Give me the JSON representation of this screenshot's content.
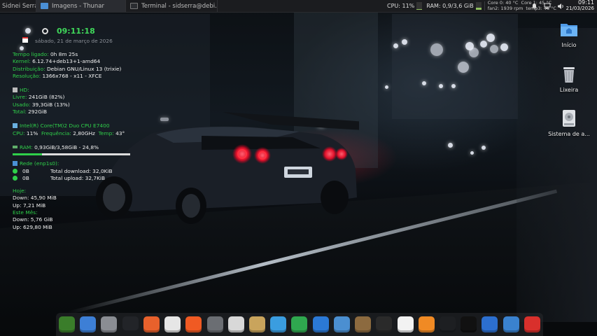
{
  "panel": {
    "user": "Sidnei Serra",
    "tasks": [
      {
        "label": "Imagens - Thunar"
      },
      {
        "label": "Terminal - sidserra@debi..."
      }
    ],
    "cpu_label": "CPU: 11%",
    "cpu_fraction": 0.11,
    "ram_label": "RAM: 0,9/3,6 GiB",
    "ram_fraction": 0.25,
    "sensors": {
      "core0": "Core 0: 40 °C",
      "core1": "Core 1: 45 °C",
      "fan": "fan2: 1939 rpm",
      "temp": "temp3: 46 °C"
    },
    "clock_time": "09:11",
    "clock_date": "21/03/2026"
  },
  "conky": {
    "time": "09:11:18",
    "date": "sábado, 21 de março de 2026",
    "uptime_label": "Tempo ligado:",
    "uptime_value": "0h 8m 25s",
    "kernel_label": "Kernel:",
    "kernel_value": "6.12.74+deb13+1-amd64",
    "distro_label": "Distribuição:",
    "distro_value": "Debian GNU/Linux 13 (trixie)",
    "res_label": "Resolução:",
    "res_value": "1366x768 - x11 - XFCE",
    "hd_title": "HD:",
    "free_label": "Livre:",
    "free_value": "241GiB (82%)",
    "used_label": "Usado:",
    "used_value": "39,3GiB (13%)",
    "total_label": "Total:",
    "total_value": "292GiB",
    "cpu_title": "Intel(R) Core(TM)2 Duo CPU     E7400",
    "cpu_label": "CPU:",
    "cpu_value": "11%",
    "freq_label": "Frequência:",
    "freq_value": "2,80GHz",
    "temp_label": "Temp:",
    "temp_value": "43°",
    "ram_label": "RAM:",
    "ram_value": "0,93GiB/3,58GiB - 24,8%",
    "ram_fraction": 0.248,
    "net_title": "Rede (enp1s0):",
    "down_value": "0B",
    "down_total": "Total download: 32,0KiB",
    "up_value": "0B",
    "up_total": "Total upload: 32,7KiB",
    "today_title": "Hoje:",
    "today_down": "Down: 45,90 MiB",
    "today_up": "Up:  7,21 MiB",
    "month_title": "Este Mês:",
    "month_down": "Down: 5,76 GiB",
    "month_up": "Up: 629,80 MiB"
  },
  "desktop": {
    "icons": [
      {
        "label": "Início",
        "icon": "home-folder-icon"
      },
      {
        "label": "Lixeira",
        "icon": "trash-icon"
      },
      {
        "label": "Sistema de a...",
        "icon": "filesystem-drive-icon"
      }
    ]
  },
  "dock": {
    "apps": [
      {
        "name": "alien-app",
        "color": "#3a7d2a"
      },
      {
        "name": "finder-app",
        "color": "#3d7fd6"
      },
      {
        "name": "settings-app",
        "color": "#8a8d93"
      },
      {
        "name": "terminal-app",
        "color": "#222428"
      },
      {
        "name": "firefox-app",
        "color": "#e8612c"
      },
      {
        "name": "chrome-app",
        "color": "#e6e6e6"
      },
      {
        "name": "brave-app",
        "color": "#f05a23"
      },
      {
        "name": "calculator-app",
        "color": "#6b6e73"
      },
      {
        "name": "screenshot-app",
        "color": "#d8d8d8"
      },
      {
        "name": "archive-app",
        "color": "#c9a45c"
      },
      {
        "name": "telegram-app",
        "color": "#3a9de0"
      },
      {
        "name": "spreadsheet-app",
        "color": "#2fa84f"
      },
      {
        "name": "writer-app",
        "color": "#2b79d6"
      },
      {
        "name": "disk-app",
        "color": "#4b8fd1"
      },
      {
        "name": "image-viewer-app",
        "color": "#8c6a3f"
      },
      {
        "name": "music-app",
        "color": "#2a2a2a"
      },
      {
        "name": "music-settings-app",
        "color": "#f2f2f2"
      },
      {
        "name": "vlc-app",
        "color": "#f08a24"
      },
      {
        "name": "system-monitor-app",
        "color": "#1d1f22"
      },
      {
        "name": "terminal2-app",
        "color": "#111"
      },
      {
        "name": "workspaces-app",
        "color": "#2c6fcf"
      },
      {
        "name": "box-app",
        "color": "#3a82cf"
      },
      {
        "name": "power-app",
        "color": "#d9302c"
      }
    ]
  }
}
